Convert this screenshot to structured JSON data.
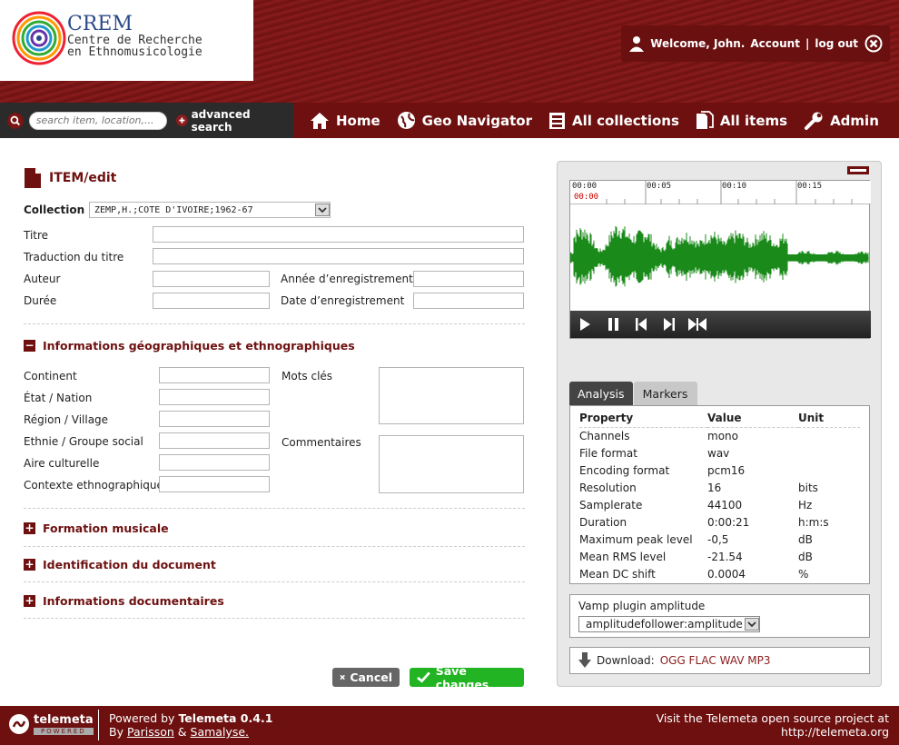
{
  "logo": {
    "name": "CREM",
    "line1": "Centre de Recherche",
    "line2": "en Ethnomusicologie"
  },
  "user": {
    "welcome": "Welcome, John.",
    "account": "Account",
    "sep": "|",
    "logout": "log out"
  },
  "search": {
    "placeholder": "search item, location,...",
    "advanced": "advanced search"
  },
  "nav": [
    {
      "label": "Home",
      "icon": "home-icon"
    },
    {
      "label": "Geo Navigator",
      "icon": "globe-icon"
    },
    {
      "label": "All collections",
      "icon": "collection-icon"
    },
    {
      "label": "All items",
      "icon": "items-icon"
    },
    {
      "label": "Admin",
      "icon": "wrench-icon"
    }
  ],
  "page": {
    "title": "ITEM/edit"
  },
  "form": {
    "collection_label": "Collection",
    "collection_value": "ZEMP,H.;COTE D'IVOIRE;1962-67",
    "titre": "Titre",
    "traduction": "Traduction du titre",
    "auteur": "Auteur",
    "annee": "Année d’enregistrement",
    "duree": "Durée",
    "date": "Date d’enregistrement",
    "section_geo": "Informations géographiques et ethnographiques",
    "continent": "Continent",
    "etat": "État / Nation",
    "region": "Région / Village",
    "ethnie": "Ethnie / Groupe social",
    "aire": "Aire culturelle",
    "contexte": "Contexte ethnographique",
    "mots": "Mots clés",
    "commentaires": "Commentaires",
    "section_formation": "Formation musicale",
    "section_identification": "Identification du document",
    "section_info": "Informations documentaires"
  },
  "buttons": {
    "cancel": "Cancel",
    "save": "Save changes"
  },
  "player": {
    "times": [
      "00:00",
      "00:05",
      "00:10",
      "00:15"
    ],
    "current": "00:00"
  },
  "tabs": {
    "analysis": "Analysis",
    "markers": "Markers"
  },
  "analysis": {
    "headers": [
      "Property",
      "Value",
      "Unit"
    ],
    "rows": [
      [
        "Channels",
        "mono",
        ""
      ],
      [
        "File format",
        "wav",
        ""
      ],
      [
        "Encoding format",
        "pcm16",
        ""
      ],
      [
        "Resolution",
        "16",
        "bits"
      ],
      [
        "Samplerate",
        "44100",
        "Hz"
      ],
      [
        "Duration",
        "0:00:21",
        "h:m:s"
      ],
      [
        "Maximum peak level",
        "-0,5",
        "dB"
      ],
      [
        "Mean RMS level",
        "-21.54",
        "dB"
      ],
      [
        "Mean DC shift",
        "0.0004",
        "%"
      ]
    ]
  },
  "vamp": {
    "label": "Vamp plugin amplitude",
    "value": "amplitudefollower:amplitude"
  },
  "download": {
    "label": "Download:",
    "formats": "OGG FLAC WAV MP3"
  },
  "footer": {
    "powered": "Powered by",
    "product": "Telemeta 0.4.1",
    "by": "By",
    "p1": "Parisson",
    "amp": "&",
    "p2": "Samalyse.",
    "visit": "Visit the Telemeta open source project at",
    "url": "http://telemeta.org",
    "brand": "telemeta",
    "brand_sub": "POWERED"
  }
}
